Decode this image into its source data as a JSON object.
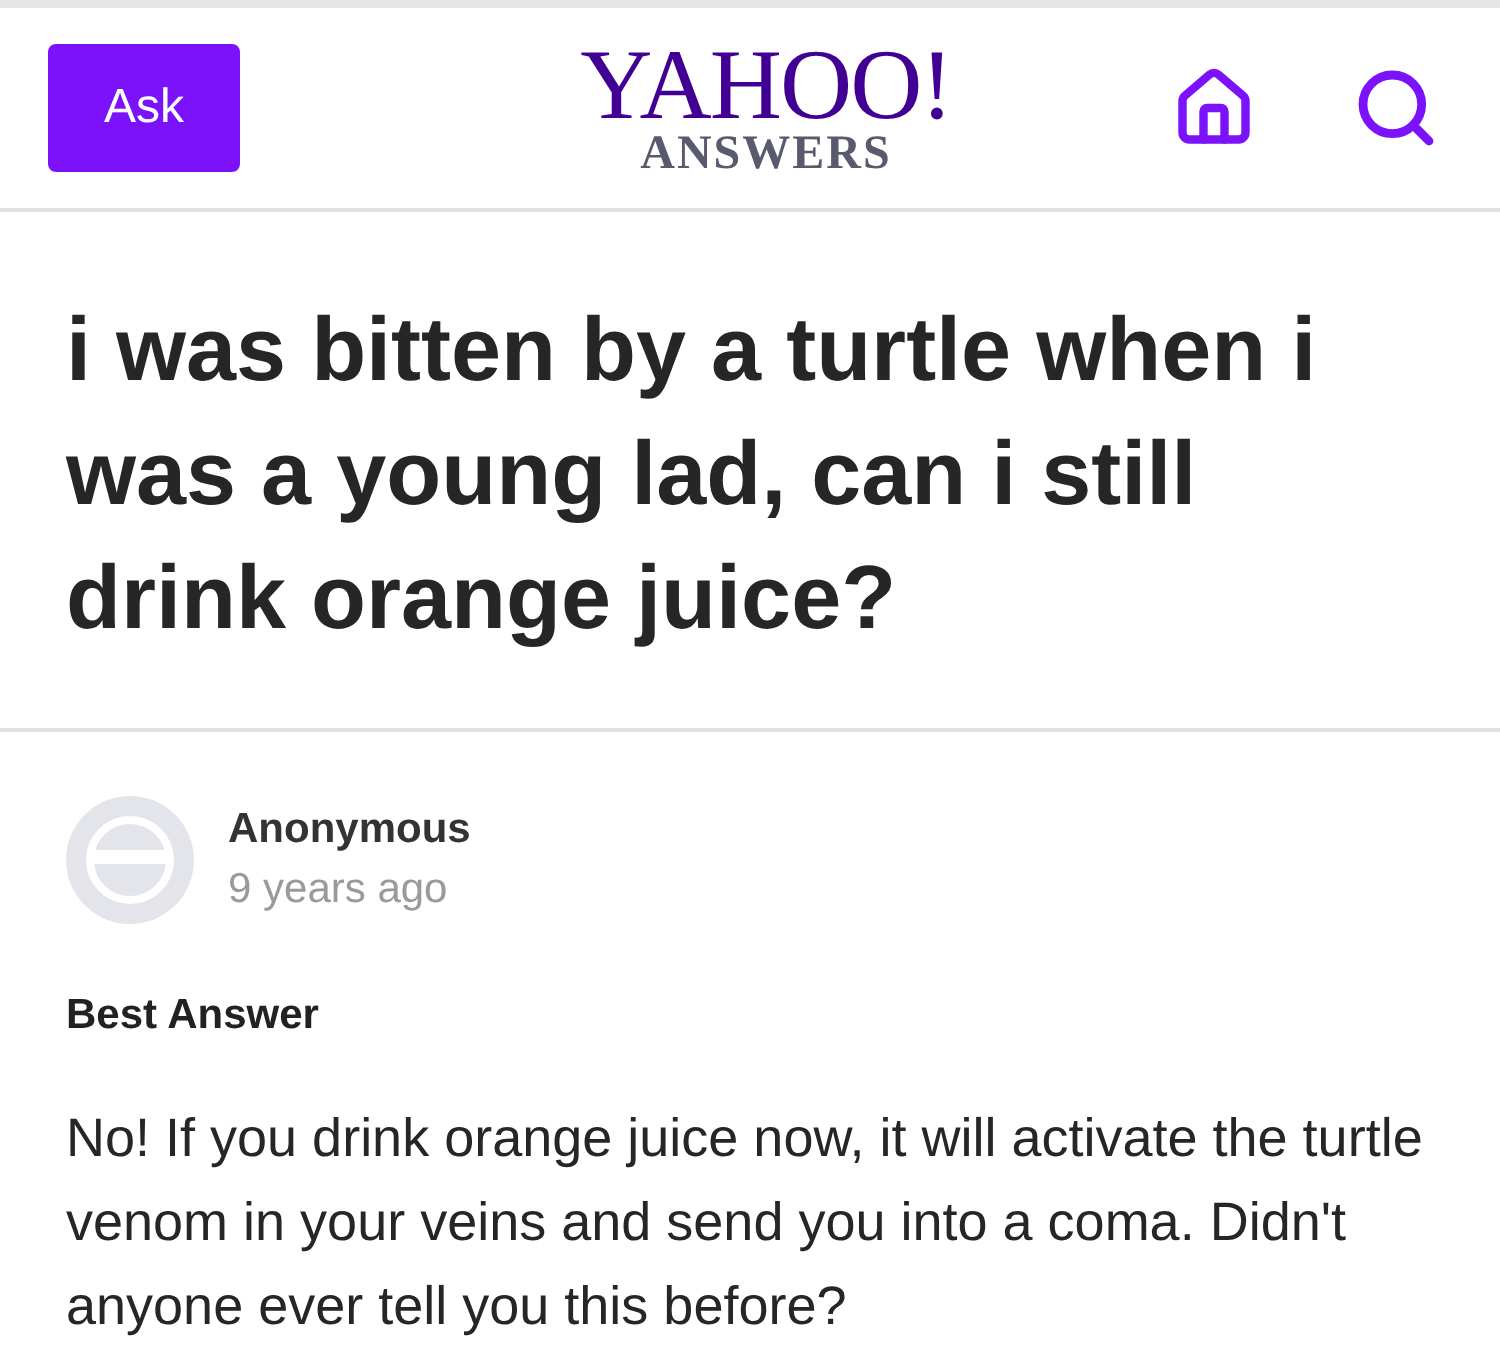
{
  "header": {
    "ask_button": "Ask",
    "logo": {
      "brand": "YAHOO!",
      "product": "ANSWERS"
    }
  },
  "question": {
    "title": "i was bitten by a turtle when i was a young lad, can i still drink orange juice?"
  },
  "answer": {
    "author": "Anonymous",
    "time": "9 years ago",
    "label": "Best Answer",
    "text": "No! If you drink orange juice now, it will activate the turtle venom in your veins and send you into a coma. Didn't anyone ever tell you this before?"
  }
}
